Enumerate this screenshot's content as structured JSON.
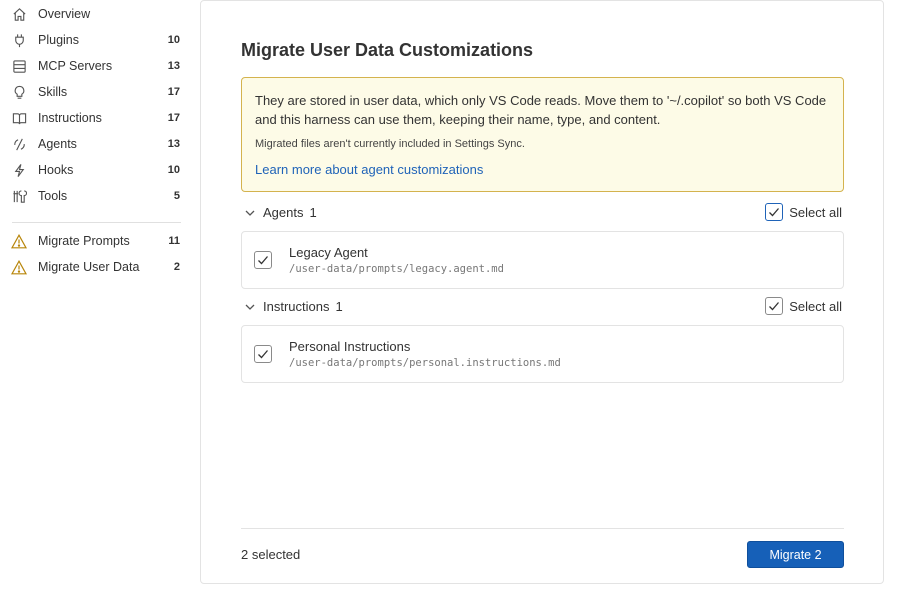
{
  "sidebar": {
    "items": [
      {
        "label": "Overview",
        "count": "",
        "icon": "home-icon"
      },
      {
        "label": "Plugins",
        "count": "10",
        "icon": "plug-icon"
      },
      {
        "label": "MCP Servers",
        "count": "13",
        "icon": "server-icon"
      },
      {
        "label": "Skills",
        "count": "17",
        "icon": "lightbulb-icon"
      },
      {
        "label": "Instructions",
        "count": "17",
        "icon": "book-icon"
      },
      {
        "label": "Agents",
        "count": "13",
        "icon": "agent-icon"
      },
      {
        "label": "Hooks",
        "count": "10",
        "icon": "lightning-icon"
      },
      {
        "label": "Tools",
        "count": "5",
        "icon": "tools-icon"
      }
    ],
    "migrate_items": [
      {
        "label": "Migrate Prompts",
        "count": "11",
        "icon": "warning-icon"
      },
      {
        "label": "Migrate User Data",
        "count": "2",
        "icon": "warning-icon"
      }
    ]
  },
  "main": {
    "title": "Migrate User Data Customizations",
    "notice": {
      "text": "They are stored in user data, which only VS Code reads. Move them to '~/.copilot' so both VS Code and this harness can use them, keeping their name, type, and content.",
      "subtext": "Migrated files aren't currently included in Settings Sync.",
      "link": "Learn more about agent customizations"
    },
    "groups": [
      {
        "name": "Agents",
        "count": "1",
        "select_all": "Select all",
        "items": [
          {
            "name": "Legacy Agent",
            "path": "/user-data/prompts/legacy.agent.md"
          }
        ]
      },
      {
        "name": "Instructions",
        "count": "1",
        "select_all": "Select all",
        "items": [
          {
            "name": "Personal Instructions",
            "path": "/user-data/prompts/personal.instructions.md"
          }
        ]
      }
    ],
    "footer": {
      "status": "2 selected",
      "button": "Migrate 2"
    }
  },
  "colors": {
    "accent": "#1660b8",
    "link": "#1f63b8",
    "notice_bg": "#fdfbe7",
    "notice_border": "#d4b34e",
    "warning": "#b8860b"
  }
}
